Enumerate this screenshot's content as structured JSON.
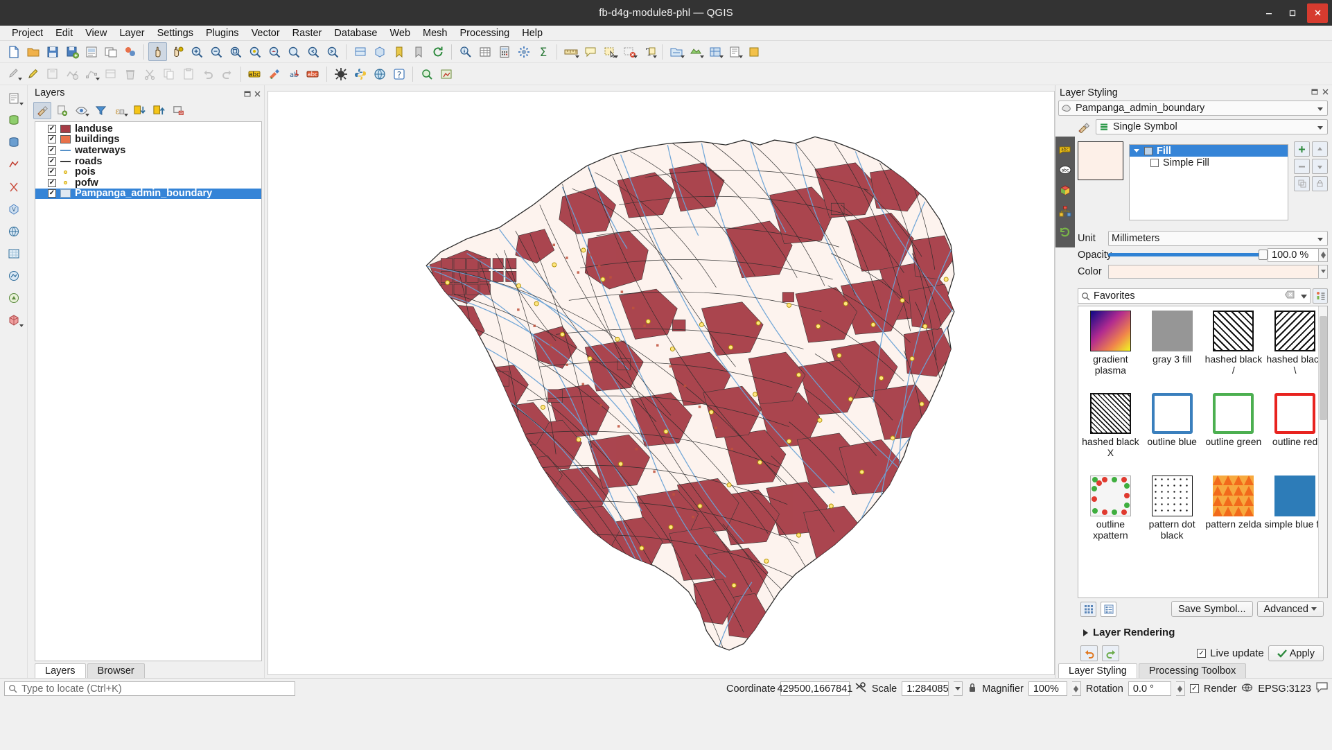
{
  "window": {
    "title": "fb-d4g-module8-phl — QGIS",
    "minimize": "–",
    "maximize": "□",
    "close": "✕"
  },
  "menubar": {
    "items": [
      "Project",
      "Edit",
      "View",
      "Layer",
      "Settings",
      "Plugins",
      "Vector",
      "Raster",
      "Database",
      "Web",
      "Mesh",
      "Processing",
      "Help"
    ]
  },
  "layers_panel": {
    "title": "Layers",
    "toolbar_icons": [
      "open-layer-styling-panel-icon",
      "add-group-icon",
      "manage-map-themes-icon",
      "filter-legend-icon",
      "filter-legend-expression-icon",
      "expand-all-icon",
      "collapse-all-icon",
      "remove-layer-icon"
    ],
    "items": [
      {
        "label": "landuse",
        "checked": true,
        "symbol": "polygon",
        "color": "#a63c46",
        "selected": false
      },
      {
        "label": "buildings",
        "checked": true,
        "symbol": "polygon",
        "color": "#e8714a",
        "selected": false
      },
      {
        "label": "waterways",
        "checked": true,
        "symbol": "line",
        "color": "#5590c8",
        "selected": false
      },
      {
        "label": "roads",
        "checked": true,
        "symbol": "line",
        "color": "#3a3a3a",
        "selected": false
      },
      {
        "label": "pois",
        "checked": true,
        "symbol": "point",
        "color": "#d8b400",
        "selected": false
      },
      {
        "label": "pofw",
        "checked": true,
        "symbol": "point",
        "color": "#d8b400",
        "selected": false
      },
      {
        "label": "Pampanga_admin_boundary",
        "checked": true,
        "symbol": "polygon",
        "color": "#dfe8f2",
        "selected": true
      }
    ],
    "tabs": [
      {
        "label": "Layers",
        "active": true
      },
      {
        "label": "Browser",
        "active": false
      }
    ]
  },
  "styling_panel": {
    "title": "Layer Styling",
    "layer_combo": "Pampanga_admin_boundary",
    "renderer_combo": "Single Symbol",
    "symbol_tree": [
      {
        "label": "Fill",
        "level": 0,
        "selected": true
      },
      {
        "label": "Simple Fill",
        "level": 1,
        "selected": false
      }
    ],
    "properties": {
      "unit_label": "Unit",
      "unit_value": "Millimeters",
      "opacity_label": "Opacity",
      "opacity_value": "100.0 %",
      "color_label": "Color",
      "color_value": "#fdf0e8"
    },
    "search_placeholder": "Favorites",
    "symbols": [
      {
        "label": "gradient plasma",
        "kind": "gradient"
      },
      {
        "label": "gray 3 fill",
        "kind": "solid-gray"
      },
      {
        "label": "hashed black /",
        "kind": "hatch-fwd"
      },
      {
        "label": "hashed black \\",
        "kind": "hatch-back"
      },
      {
        "label": "hashed black X",
        "kind": "hatch-cross"
      },
      {
        "label": "outline blue",
        "kind": "outline-blue"
      },
      {
        "label": "outline green",
        "kind": "outline-green"
      },
      {
        "label": "outline red",
        "kind": "outline-red"
      },
      {
        "label": "outline xpattern",
        "kind": "outline-xpattern"
      },
      {
        "label": "pattern dot black",
        "kind": "dots"
      },
      {
        "label": "pattern zelda",
        "kind": "zelda"
      },
      {
        "label": "simple blue fill",
        "kind": "solid-blue"
      }
    ],
    "save_symbol_label": "Save Symbol...",
    "advanced_label": "Advanced",
    "layer_rendering_label": "Layer Rendering",
    "live_update_label": "Live update",
    "apply_label": "Apply",
    "tabs": [
      {
        "label": "Layer Styling",
        "active": true
      },
      {
        "label": "Processing Toolbox",
        "active": false
      }
    ],
    "side_icons": [
      "symbology-icon",
      "labels-icon",
      "masks-icon",
      "3d-view-icon",
      "diagrams-icon",
      "history-icon"
    ]
  },
  "statusbar": {
    "locator_placeholder": "Type to locate (Ctrl+K)",
    "coordinate_label": "Coordinate",
    "coordinate_value": "429500,1667841",
    "scale_label": "Scale",
    "scale_value": "1:284085",
    "magnifier_label": "Magnifier",
    "magnifier_value": "100%",
    "rotation_label": "Rotation",
    "rotation_value": "0.0 °",
    "render_label": "Render",
    "crs_label": "EPSG:3123",
    "messages_icon": "messages-icon"
  },
  "colors": {
    "accent": "#3584d7",
    "landuse": "#a63c46",
    "waterway": "#6ba3d6",
    "title_bar": "#333333",
    "close_button": "#d63b2f",
    "map_background": "#ffffff",
    "boundary_fill": "#fdf3ee"
  }
}
